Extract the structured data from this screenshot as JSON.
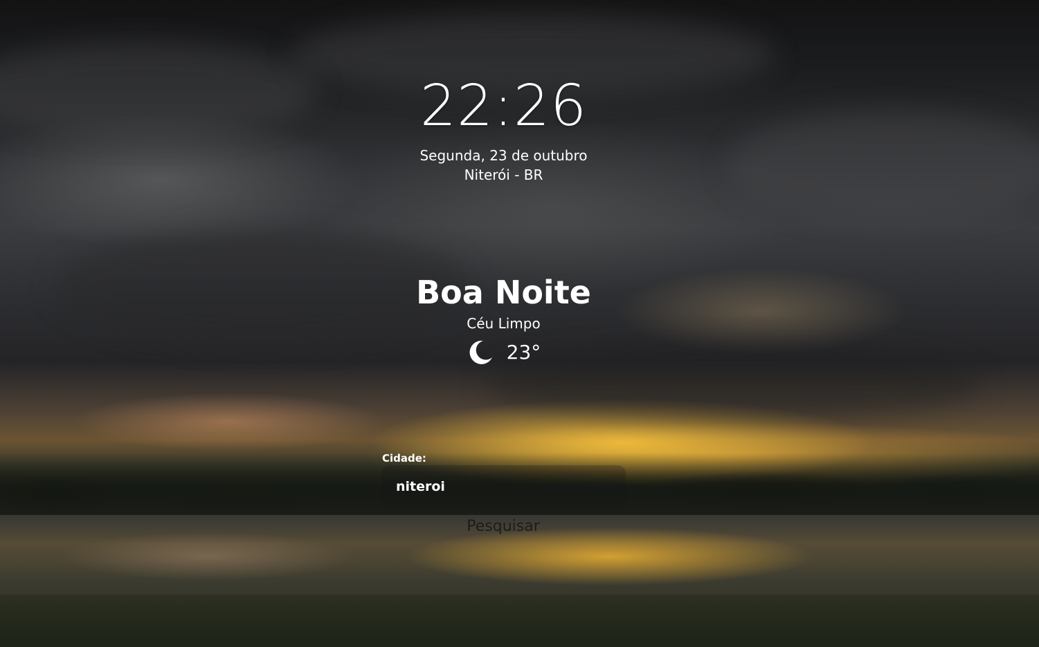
{
  "clock": {
    "time": "22:26",
    "date": "Segunda, 23 de outubro",
    "location": "Niterói - BR"
  },
  "weather": {
    "greeting": "Boa Noite",
    "condition": "Céu Limpo",
    "icon": "moon-icon",
    "temperature": "23°"
  },
  "search": {
    "label": "Cidade:",
    "value": "niteroi",
    "button_label": "Pesquisar"
  },
  "colors": {
    "text": "#ffffff",
    "button_text": "#1c1c1c",
    "input_background": "rgba(20,20,20,0.25)"
  }
}
